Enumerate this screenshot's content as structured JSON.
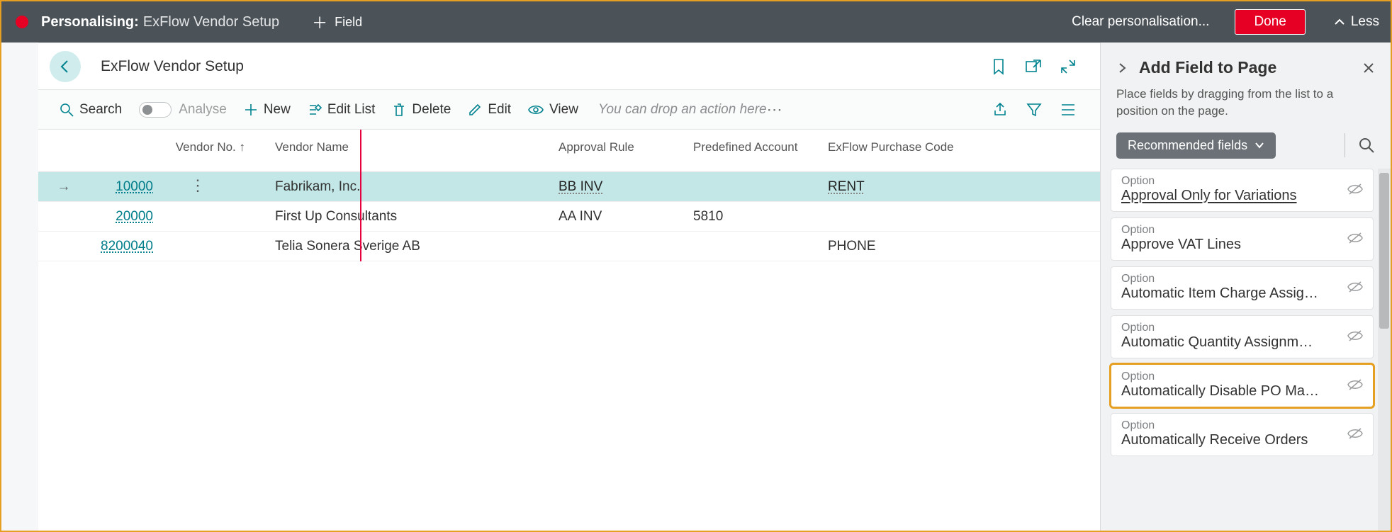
{
  "topbar": {
    "personalising_label": "Personalising:",
    "page_name": "ExFlow Vendor Setup",
    "add_field": "Field",
    "clear": "Clear personalisation...",
    "done": "Done",
    "less": "Less"
  },
  "page": {
    "title": "ExFlow Vendor Setup"
  },
  "actions": {
    "search": "Search",
    "analyse": "Analyse",
    "new": "New",
    "edit_list": "Edit List",
    "delete": "Delete",
    "edit": "Edit",
    "view": "View",
    "dropzone": "You can drop an action here"
  },
  "columns": {
    "vendor_no": "Vendor No. ↑",
    "vendor_name": "Vendor Name",
    "approval_rule": "Approval Rule",
    "predefined_account": "Predefined Account",
    "exflow_purchase_code": "ExFlow Purchase Code"
  },
  "rows": [
    {
      "vendor_no": "10000",
      "vendor_name": "Fabrikam, Inc.",
      "approval_rule": "BB INV",
      "predefined_account": "",
      "exflow_purchase_code": "RENT",
      "selected": true
    },
    {
      "vendor_no": "20000",
      "vendor_name": "First Up Consultants",
      "approval_rule": "AA INV",
      "predefined_account": "5810",
      "exflow_purchase_code": "",
      "selected": false
    },
    {
      "vendor_no": "8200040",
      "vendor_name": "Telia Sonera Sverige AB",
      "approval_rule": "",
      "predefined_account": "",
      "exflow_purchase_code": "PHONE",
      "selected": false
    }
  ],
  "addfield": {
    "title": "Add Field to Page",
    "help": "Place fields by dragging from the list to a position on the page.",
    "filter_label": "Recommended fields",
    "type_label": "Option",
    "items": [
      {
        "name": "Approval Only for Variations",
        "underline": true,
        "highlight": false
      },
      {
        "name": "Approve VAT Lines",
        "underline": false,
        "highlight": false
      },
      {
        "name": "Automatic Item Charge Assig…",
        "underline": false,
        "highlight": false
      },
      {
        "name": "Automatic Quantity Assignm…",
        "underline": false,
        "highlight": false
      },
      {
        "name": "Automatically Disable PO Ma…",
        "underline": false,
        "highlight": true
      },
      {
        "name": "Automatically Receive Orders",
        "underline": false,
        "highlight": false
      }
    ]
  }
}
